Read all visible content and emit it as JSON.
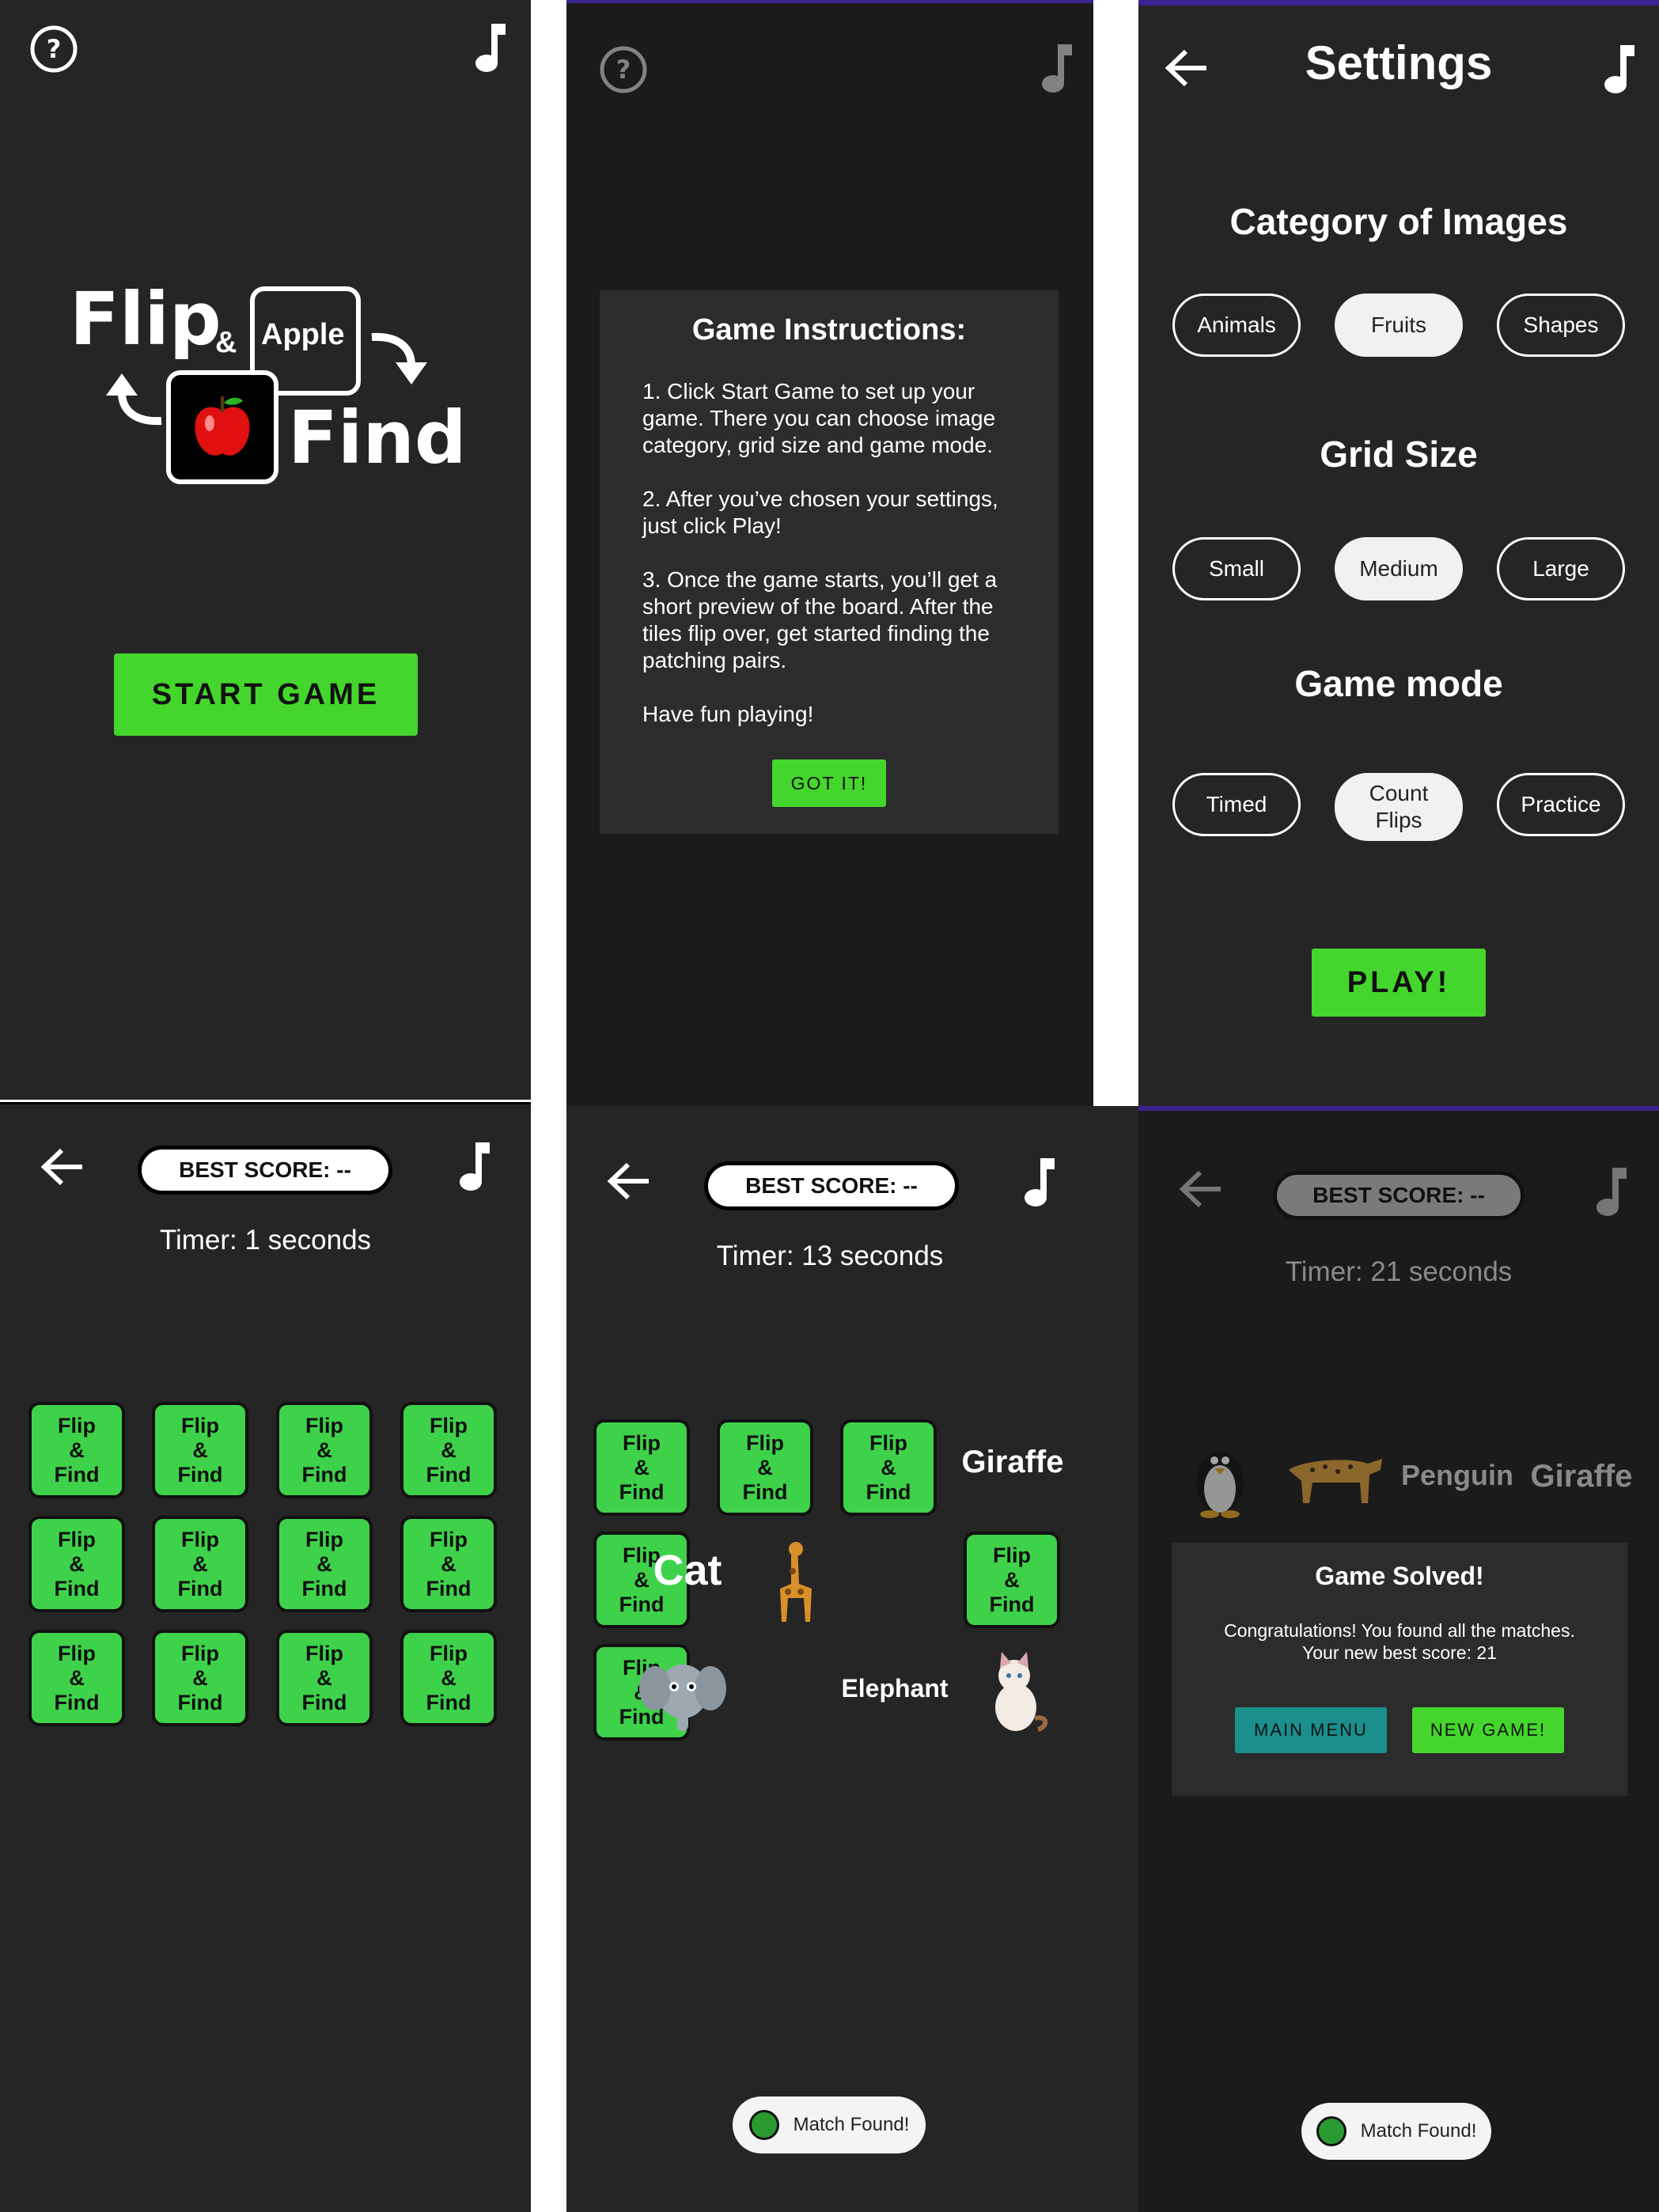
{
  "screen1": {
    "logo": {
      "flip": "Flip",
      "amp": "&",
      "apple": "Apple",
      "find": "Find"
    },
    "start_button": "START GAME"
  },
  "screen2": {
    "dialog": {
      "title": "Game Instructions:",
      "steps": [
        "1. Click Start Game to set up your game. There you can choose image category, grid size and game mode.",
        "2. After you’ve chosen your settings, just click Play!",
        "3. Once the game starts, you’ll get a short preview of the board. After the tiles flip over, get started finding the patching pairs.",
        "Have fun playing!"
      ],
      "button": "GOT IT!"
    }
  },
  "screen3": {
    "title": "Settings",
    "category": {
      "heading": "Category of Images",
      "options": [
        "Animals",
        "Fruits",
        "Shapes"
      ],
      "selected": "Fruits"
    },
    "grid": {
      "heading": "Grid Size",
      "options": [
        "Small",
        "Medium",
        "Large"
      ],
      "selected": "Medium"
    },
    "mode": {
      "heading": "Game mode",
      "options": [
        "Timed",
        "Count Flips",
        "Practice"
      ],
      "option_lines": [
        [
          "Timed"
        ],
        [
          "Count",
          "Flips"
        ],
        [
          "Practice"
        ]
      ],
      "selected": "Count Flips"
    },
    "play_button": "PLAY!"
  },
  "game": {
    "best_score": "BEST SCORE: --",
    "tile": {
      "l1": "Flip",
      "l2": "&",
      "l3": "Find"
    }
  },
  "screen4": {
    "timer": "Timer: 1 seconds"
  },
  "screen5": {
    "timer": "Timer: 13 seconds",
    "words": {
      "giraffe": "Giraffe",
      "cat": "Cat",
      "elephant": "Elephant"
    },
    "toast": "Match Found!"
  },
  "screen6": {
    "timer": "Timer: 21 seconds",
    "words": {
      "penguin": "Penguin",
      "giraffe": "Giraffe"
    },
    "dialog": {
      "title": "Game Solved!",
      "line1": "Congratulations! You found all the matches.",
      "line2": "Your new best score: 21",
      "main_menu": "MAIN MENU",
      "new_game": "NEW GAME!"
    },
    "toast": "Match Found!"
  },
  "colors": {
    "panel_bg": "#252525",
    "accent_green": "#44d62c",
    "tile_green": "#3ed24a",
    "teal": "#1a8f8c"
  }
}
